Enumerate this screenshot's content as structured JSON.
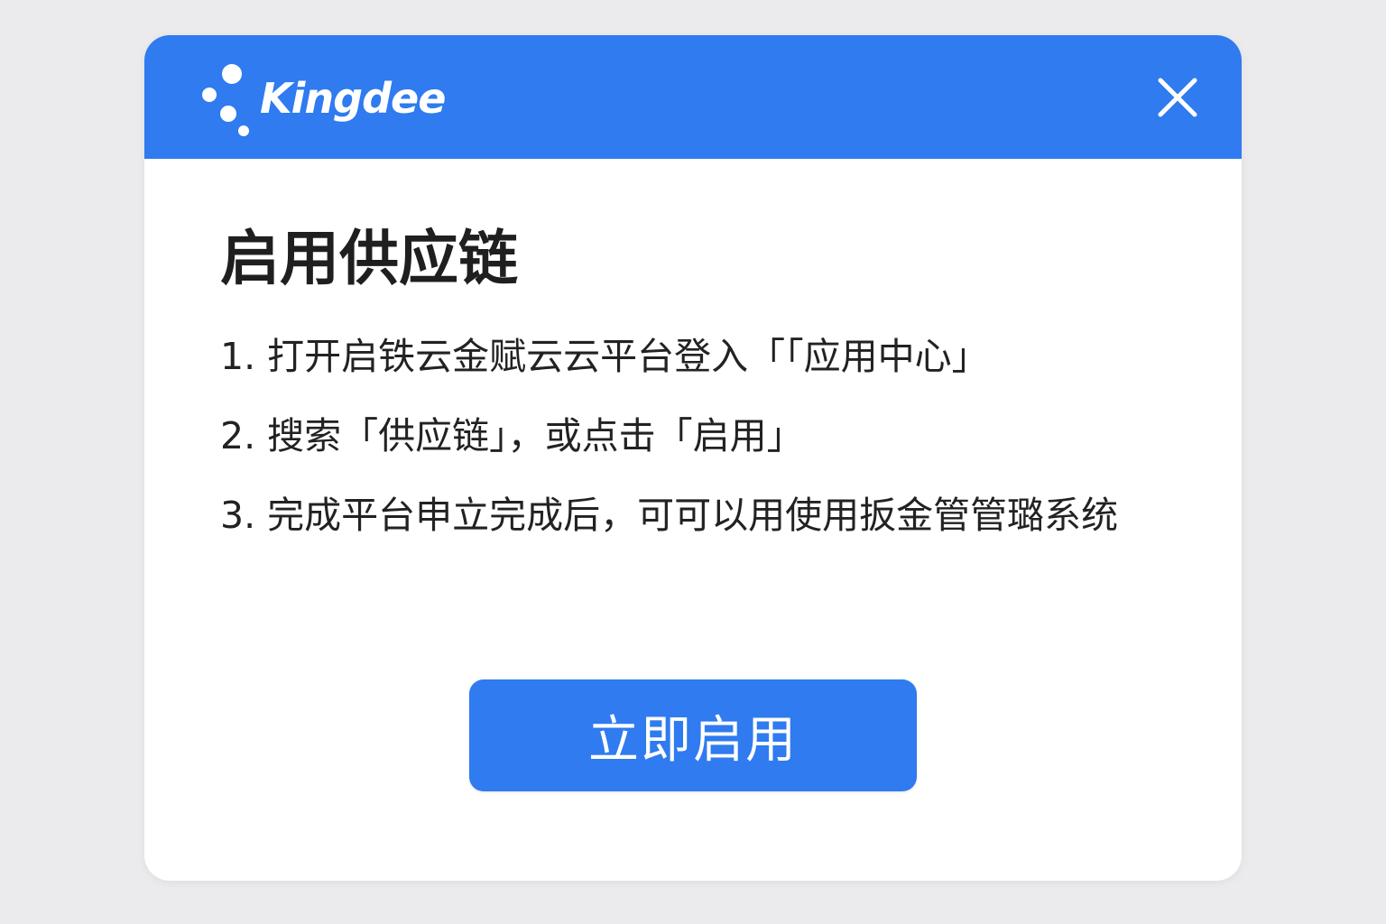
{
  "header": {
    "brand": "Kingdee",
    "logo_icon": "kingdee-dots-logo",
    "close_icon": "close-icon",
    "color": "#2f7bef"
  },
  "dialog": {
    "title": "启用供应链",
    "steps": [
      "1.  打开启铁云金赋云云平台登入「「应用中心」",
      "2.  搜索「供应链」，或点击「启用」",
      "3.  完成平台申立完成后，可可以用使用扳金管管璐系统"
    ],
    "primary_button_label": "立即启用"
  },
  "colors": {
    "accent": "#2f7bef",
    "background": "#ebebed",
    "surface": "#ffffff",
    "text": "#1f1f1f"
  }
}
